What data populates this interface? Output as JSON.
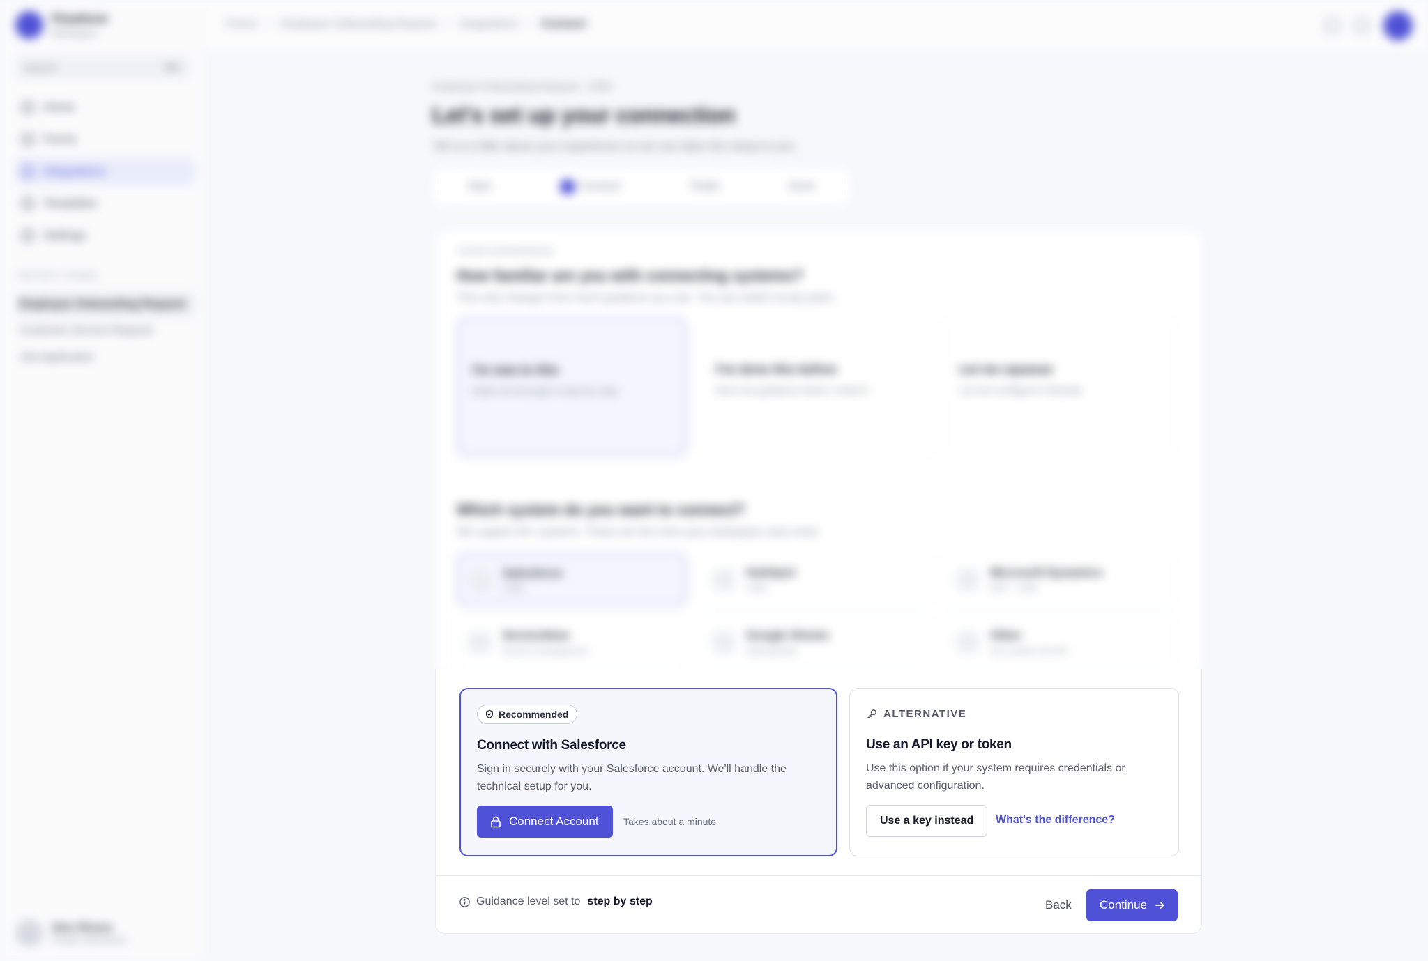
{
  "app": {
    "name": "Flowform",
    "subtitle": "Workspace"
  },
  "sidebar": {
    "search_placeholder": "Search",
    "search_shortcut": "⌘K",
    "items": [
      {
        "label": "Home"
      },
      {
        "label": "Forms"
      },
      {
        "label": "Integrations"
      },
      {
        "label": "Templates"
      },
      {
        "label": "Settings"
      }
    ],
    "recent_title": "Recent forms",
    "recent": [
      {
        "label": "Employee Onboarding Request"
      },
      {
        "label": "Customer Service Request"
      },
      {
        "label": "Job Application"
      }
    ],
    "user": {
      "name": "Alex Rivera",
      "role": "People Operations"
    }
  },
  "breadcrumb": [
    "Forms",
    "Employee Onboarding Request",
    "Integrations",
    "Connect"
  ],
  "header": {
    "context": "Employee Onboarding Request · CRM",
    "title": "Let's set up your connection",
    "lead": "Tell us a little about your experience so we can tailor the setup to you."
  },
  "stepper": [
    "Start",
    "Connect",
    "Fields",
    "Done"
  ],
  "experience": {
    "label": "Your experience",
    "title": "How familiar are you with connecting systems?",
    "subtitle": "This only changes how much guidance you see. You can switch at any point.",
    "options": [
      {
        "title": "I'm new to this",
        "sub": "Walk me through it step by step",
        "badge": "Recommended"
      },
      {
        "title": "I've done this before",
        "sub": "Give me guidance when I need it"
      },
      {
        "title": "Let me squeeze",
        "sub": "Let me configure it directly"
      }
    ]
  },
  "systems": {
    "title": "Which system do you want to connect?",
    "subtitle": "We support 40+ systems. These are the ones your workspace uses most.",
    "items": [
      {
        "name": "Salesforce",
        "sub": "CRM"
      },
      {
        "name": "HubSpot",
        "sub": "CRM"
      },
      {
        "name": "Microsoft Dynamics",
        "sub": "ERP · CRM"
      },
      {
        "name": "ServiceNow",
        "sub": "Service management"
      },
      {
        "name": "Google Sheets",
        "sub": "Spreadsheet"
      },
      {
        "name": "Other",
        "sub": "Any system via API"
      }
    ]
  },
  "connect": {
    "recommended_badge": "Recommended",
    "title": "Connect with Salesforce",
    "description": "Sign in securely with your Salesforce account. We'll handle the technical setup for you.",
    "button": "Connect Account",
    "hint": "Takes about a minute"
  },
  "alternative": {
    "label": "ALTERNATIVE",
    "title": "Use an API key or token",
    "description": "Use this option if your system requires credentials or advanced configuration.",
    "button": "Use a key instead",
    "link": "What's the difference?"
  },
  "footer": {
    "note_prefix": "Guidance level set to",
    "note_value": "step by step",
    "back": "Back",
    "continue": "Continue"
  },
  "colors": {
    "accent": "#4f52d6",
    "accent_soft": "#f6f7fd",
    "border": "#dcdfe6"
  }
}
